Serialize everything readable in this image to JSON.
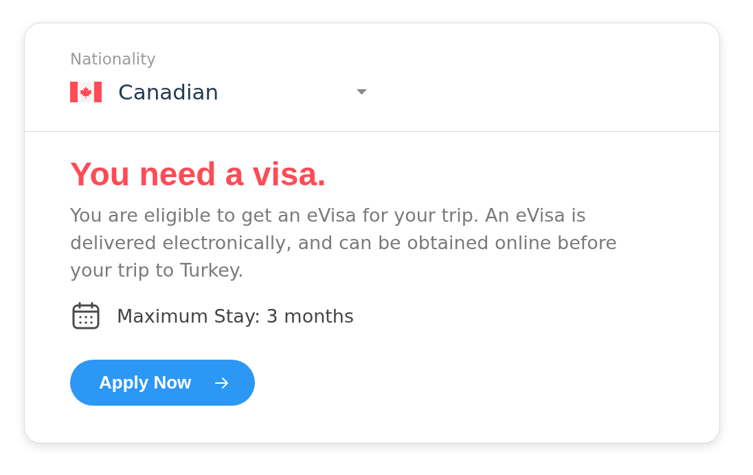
{
  "nationality": {
    "label": "Nationality",
    "value": "Canadian"
  },
  "result": {
    "heading": "You need a visa.",
    "description": "You are eligible to get an eVisa for your trip. An eVisa is delivered electronically, and can be obtained online before your trip to Turkey.",
    "stay": "Maximum Stay: 3 months"
  },
  "apply_button": {
    "label": "Apply Now"
  }
}
